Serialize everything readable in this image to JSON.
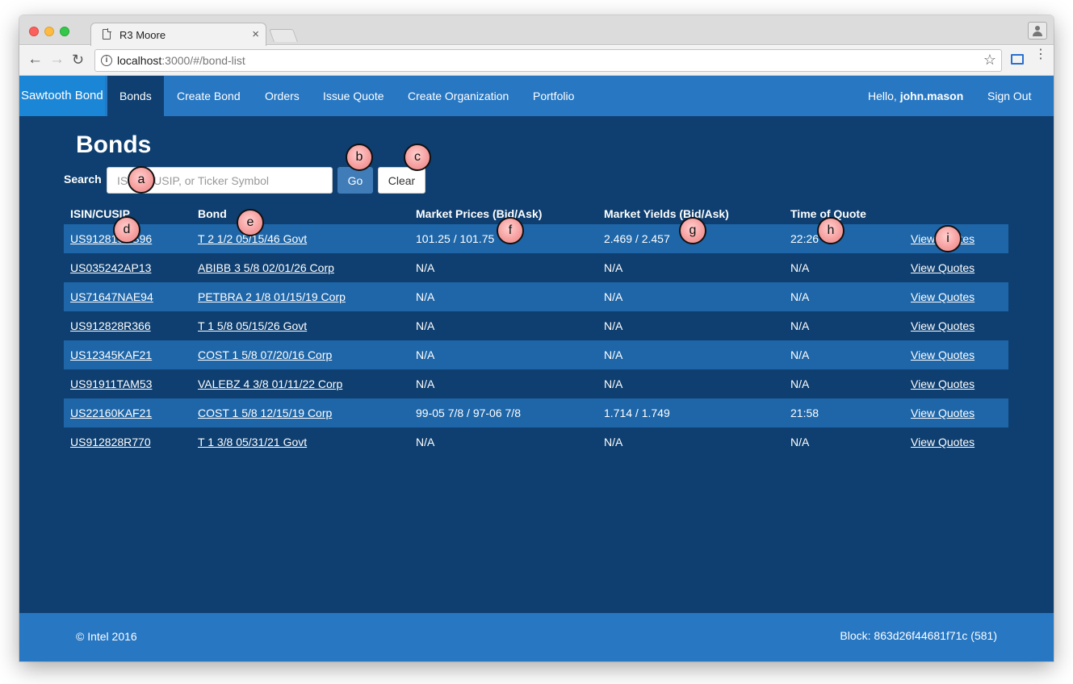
{
  "browser": {
    "tab_title": "R3 Moore",
    "tab_close": "×",
    "url_host": "localhost",
    "url_rest": ":3000/#/bond-list",
    "info_icon": "i",
    "back": "←",
    "forward": "→",
    "reload": "↻",
    "star": "☆",
    "menu": "⋮"
  },
  "navbar": {
    "brand": "Sawtooth Bond",
    "links": [
      "Bonds",
      "Create Bond",
      "Orders",
      "Issue Quote",
      "Create Organization",
      "Portfolio"
    ],
    "active": "Bonds",
    "hello_prefix": "Hello, ",
    "username": "john.mason",
    "sign_out": "Sign Out"
  },
  "page": {
    "title": "Bonds",
    "search_label": "Search",
    "search_placeholder": "ISIN, CUSIP, or Ticker Symbol",
    "go_label": "Go",
    "clear_label": "Clear"
  },
  "table": {
    "headers": [
      "ISIN/CUSIP",
      "Bond",
      "Market Prices (Bid/Ask)",
      "Market Yields (Bid/Ask)",
      "Time of Quote",
      ""
    ],
    "rows": [
      {
        "isin": "US912810RS96",
        "bond": "T 2 1/2 05/15/46 Govt",
        "prices": "101.25 / 101.75",
        "yields": "2.469 / 2.457",
        "time": "22:26",
        "action": "View Quotes"
      },
      {
        "isin": "US035242AP13",
        "bond": "ABIBB 3 5/8 02/01/26 Corp",
        "prices": "N/A",
        "yields": "N/A",
        "time": "N/A",
        "action": "View Quotes"
      },
      {
        "isin": "US71647NAE94",
        "bond": "PETBRA 2 1/8 01/15/19 Corp",
        "prices": "N/A",
        "yields": "N/A",
        "time": "N/A",
        "action": "View Quotes"
      },
      {
        "isin": "US912828R366",
        "bond": "T 1 5/8 05/15/26 Govt",
        "prices": "N/A",
        "yields": "N/A",
        "time": "N/A",
        "action": "View Quotes"
      },
      {
        "isin": "US12345KAF21",
        "bond": "COST 1 5/8 07/20/16 Corp",
        "prices": "N/A",
        "yields": "N/A",
        "time": "N/A",
        "action": "View Quotes"
      },
      {
        "isin": "US91911TAM53",
        "bond": "VALEBZ 4 3/8 01/11/22 Corp",
        "prices": "N/A",
        "yields": "N/A",
        "time": "N/A",
        "action": "View Quotes"
      },
      {
        "isin": "US22160KAF21",
        "bond": "COST 1 5/8 12/15/19 Corp",
        "prices": "99-05 7/8 / 97-06 7/8",
        "yields": "1.714 / 1.749",
        "time": "21:58",
        "action": "View Quotes"
      },
      {
        "isin": "US912828R770",
        "bond": "T 1 3/8 05/31/21 Govt",
        "prices": "N/A",
        "yields": "N/A",
        "time": "N/A",
        "action": "View Quotes"
      }
    ]
  },
  "footer": {
    "copyright": "© Intel 2016",
    "block": "Block: 863d26f44681f71c (581)"
  },
  "markers": [
    "a",
    "b",
    "c",
    "d",
    "e",
    "f",
    "g",
    "h",
    "i"
  ],
  "colors": {
    "page_bg": "#0e3f70",
    "navbar_bg": "#2777c3",
    "row_stripe": "#1e66a8",
    "marker_fill": "#f7a0a0"
  }
}
